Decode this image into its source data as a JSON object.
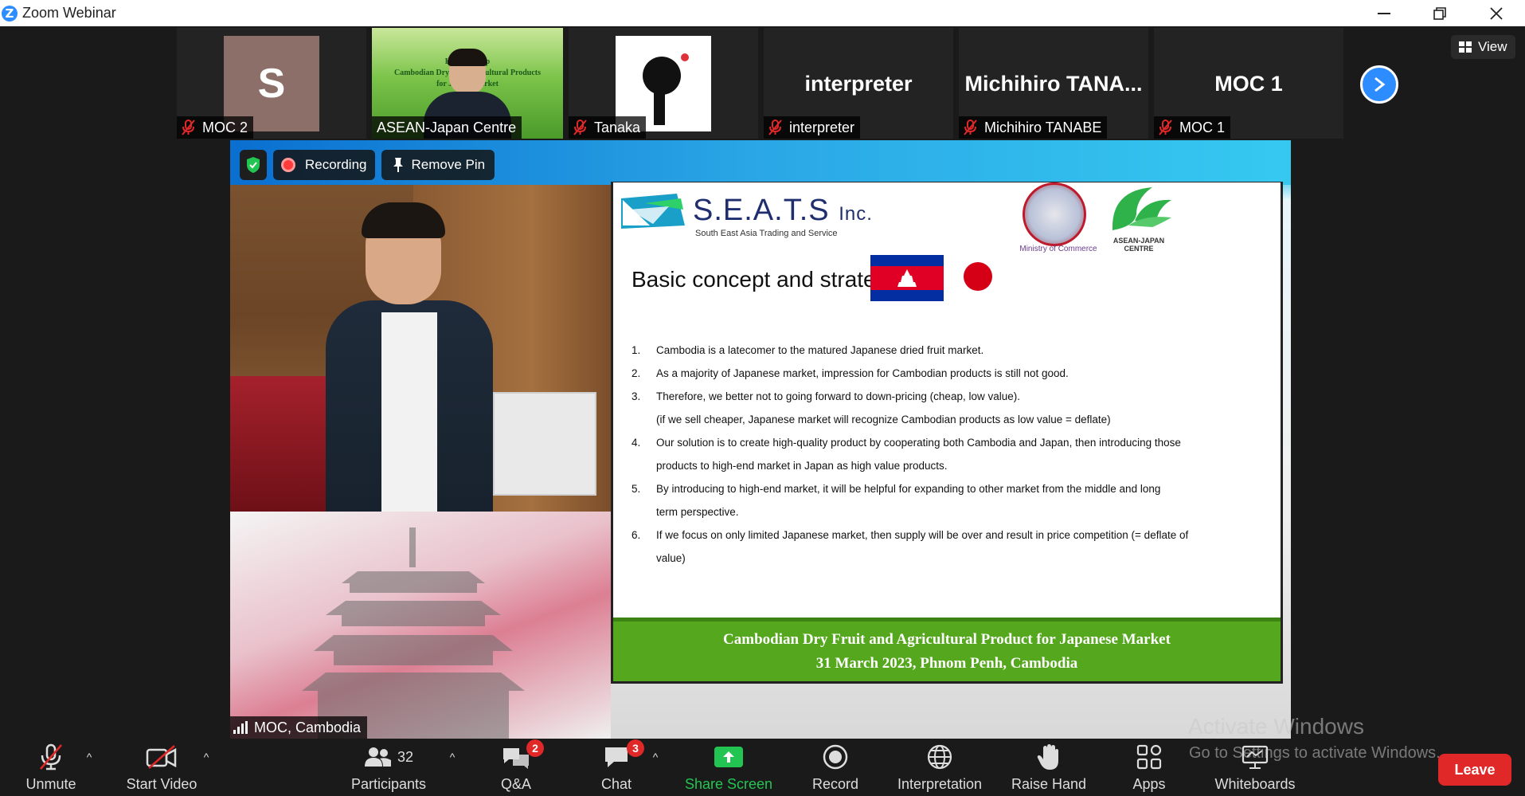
{
  "window": {
    "title": "Zoom Webinar",
    "logo_letter": "Z"
  },
  "thumbnails": [
    {
      "tag": "MOC 2",
      "avatar_letter": "S",
      "muted": true
    },
    {
      "tag": "ASEAN-Japan Centre",
      "muted": false,
      "video_text": [
        "Hy",
        "hop",
        "Cambodian Dry Fr",
        "gricultural Products",
        "for Ja",
        "arket"
      ]
    },
    {
      "tag": "Tanaka",
      "muted": true
    },
    {
      "tag": "interpreter",
      "big_name": "interpreter",
      "muted": true
    },
    {
      "tag": "Michihiro TANABE",
      "big_name": "Michihiro  TANA...",
      "muted": true
    },
    {
      "tag": "MOC 1",
      "big_name": "MOC 1",
      "muted": true
    }
  ],
  "view_button": {
    "label": "View"
  },
  "stage": {
    "recording_label": "Recording",
    "remove_pin_label": "Remove Pin",
    "speaker_name": "MOC, Cambodia"
  },
  "slide": {
    "company": "S.E.A.T.S",
    "company_suffix": "Inc.",
    "tagline": "South East Asia Trading and Service",
    "title": "Basic concept and strategy",
    "moc_caption": "Ministry of Commerce",
    "ajc_caption": "ASEAN-JAPAN CENTRE",
    "points": [
      {
        "num": "1.",
        "text": "Cambodia is a latecomer to the matured Japanese dried fruit market."
      },
      {
        "num": "2.",
        "text": "As a majority of Japanese market, impression for Cambodian products is still not good."
      },
      {
        "num": "3.",
        "text": "Therefore, we better not to going forward to down-pricing (cheap, low value)."
      },
      {
        "num": "",
        "text": "(if we sell cheaper, Japanese market will recognize Cambodian products as low value = deflate)"
      },
      {
        "num": "4.",
        "text": "Our solution is to create high-quality product by cooperating both Cambodia and Japan, then introducing those"
      },
      {
        "num": "",
        "text": "products to high-end market in Japan as high value products."
      },
      {
        "num": "5.",
        "text": "By introducing to high-end market, it will be helpful for expanding to other market from the middle and long"
      },
      {
        "num": "",
        "text": "term perspective."
      },
      {
        "num": "6.",
        "text": "If we focus on only limited Japanese market, then supply will be over and result in price competition (= deflate of"
      },
      {
        "num": "",
        "text": "value)"
      }
    ],
    "footer_line1": "Cambodian Dry Fruit and Agricultural Product for Japanese Market",
    "footer_line2": "31 March 2023, Phnom Penh, Cambodia"
  },
  "toolbar": {
    "unmute": "Unmute",
    "start_video": "Start Video",
    "participants": "Participants",
    "participants_count": "32",
    "qa": "Q&A",
    "qa_badge": "2",
    "chat": "Chat",
    "chat_badge": "3",
    "share_screen": "Share Screen",
    "record": "Record",
    "interpretation": "Interpretation",
    "raise_hand": "Raise Hand",
    "apps": "Apps",
    "whiteboards": "Whiteboards",
    "leave": "Leave"
  },
  "watermark": {
    "line1": "Activate Windows",
    "line2": "Go to Settings to activate Windows."
  },
  "colors": {
    "zoom_blue": "#2d8cff",
    "leave_red": "#e02828",
    "share_green": "#23c552",
    "slide_green": "#55a81e"
  }
}
